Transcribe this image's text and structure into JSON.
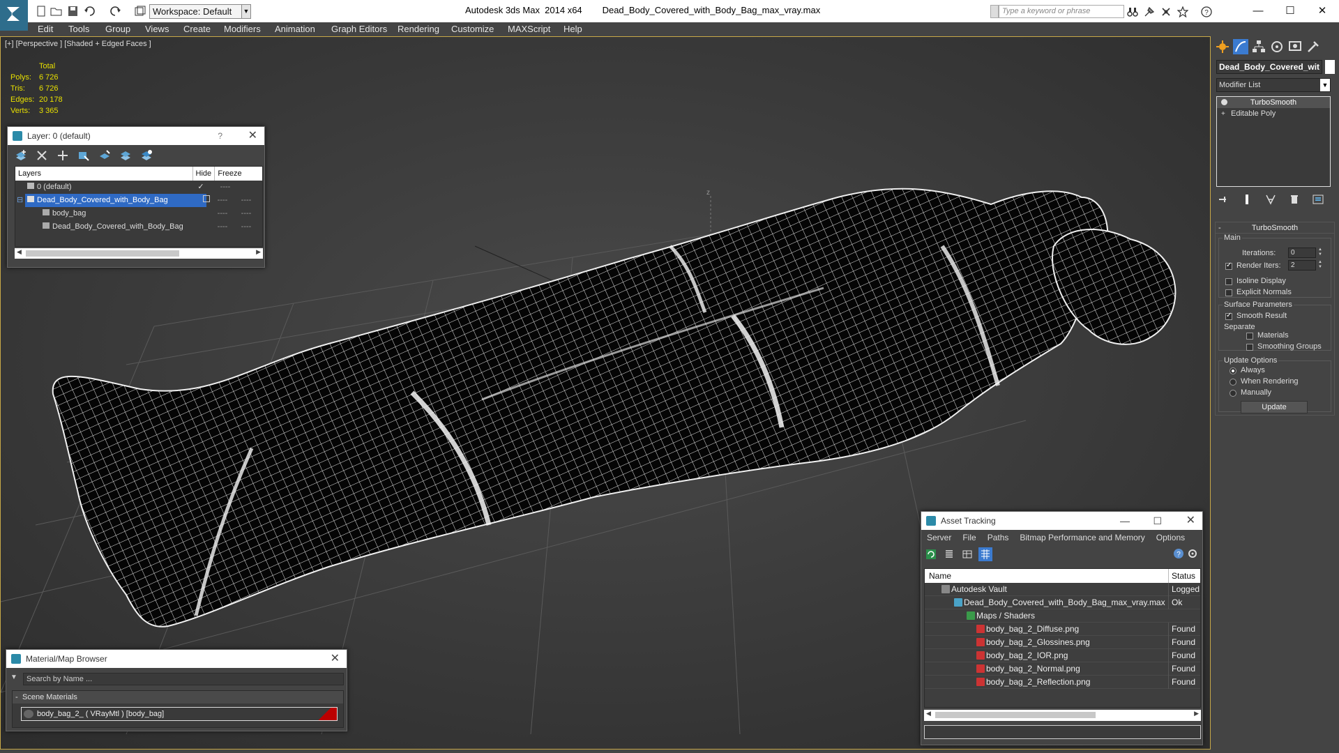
{
  "app": {
    "title": "Autodesk 3ds Max  2014 x64",
    "file": "Dead_Body_Covered_with_Body_Bag_max_vray.max",
    "workspace": "Workspace: Default",
    "search_placeholder": "Type a keyword or phrase"
  },
  "menu": [
    "Edit",
    "Tools",
    "Group",
    "Views",
    "Create",
    "Modifiers",
    "Animation",
    "Graph Editors",
    "Rendering",
    "Customize",
    "MAXScript",
    "Help"
  ],
  "viewport": {
    "label": "[+] [Perspective ] [Shaded + Edged Faces ]",
    "stats": {
      "header": "Total",
      "rows": [
        {
          "k": "Polys:",
          "v": "6 726"
        },
        {
          "k": "Tris:",
          "v": "6 726"
        },
        {
          "k": "Edges:",
          "v": "20 178"
        },
        {
          "k": "Verts:",
          "v": "3 365"
        }
      ]
    },
    "axis_label": "z"
  },
  "layer_panel": {
    "title": "Layer: 0 (default)",
    "help": "?",
    "columns": {
      "layers": "Layers",
      "hide": "Hide",
      "freeze": "Freeze"
    },
    "rows": [
      {
        "name": "0 (default)",
        "hide": "✓",
        "freeze": "----"
      },
      {
        "name": "Dead_Body_Covered_with_Body_Bag",
        "hide": "",
        "freeze": "----"
      },
      {
        "name": "body_bag",
        "hide": "----",
        "freeze": "----"
      },
      {
        "name": "Dead_Body_Covered_with_Body_Bag",
        "hide": "----",
        "freeze": "----"
      }
    ],
    "row2_hide_dashes": "----"
  },
  "material_browser": {
    "title": "Material/Map Browser",
    "search_placeholder": "Search by Name ...",
    "group": "Scene Materials",
    "item": "body_bag_2_  ( VRayMtl ) [body_bag]"
  },
  "asset_tracking": {
    "title": "Asset Tracking",
    "menu": [
      "Server",
      "File",
      "Paths",
      "Bitmap Performance and Memory",
      "Options"
    ],
    "columns": {
      "name": "Name",
      "status": "Status"
    },
    "rows": [
      {
        "name": "Autodesk Vault",
        "status": "Logged Out",
        "indent": 1,
        "icon": "vault-icon"
      },
      {
        "name": "Dead_Body_Covered_with_Body_Bag_max_vray.max",
        "status": "Ok",
        "indent": 2,
        "icon": "max-file-icon"
      },
      {
        "name": "Maps / Shaders",
        "status": "",
        "indent": 3,
        "icon": "maps-icon"
      },
      {
        "name": "body_bag_2_Diffuse.png",
        "status": "Found",
        "indent": 4,
        "icon": "png-icon"
      },
      {
        "name": "body_bag_2_Glossines.png",
        "status": "Found",
        "indent": 4,
        "icon": "png-icon"
      },
      {
        "name": "body_bag_2_IOR.png",
        "status": "Found",
        "indent": 4,
        "icon": "png-icon"
      },
      {
        "name": "body_bag_2_Normal.png",
        "status": "Found",
        "indent": 4,
        "icon": "png-icon"
      },
      {
        "name": "body_bag_2_Reflection.png",
        "status": "Found",
        "indent": 4,
        "icon": "png-icon"
      }
    ]
  },
  "command_panel": {
    "object_name": "Dead_Body_Covered_wit",
    "modifier_list": "Modifier List",
    "stack": [
      "TurboSmooth",
      "Editable Poly"
    ],
    "turbosmooth": {
      "title": "TurboSmooth",
      "main": "Main",
      "iterations_label": "Iterations:",
      "iterations": "0",
      "render_iters_label": "Render Iters:",
      "render_iters": "2",
      "isoline": "Isoline Display",
      "explicit_normals": "Explicit Normals",
      "surface_params": "Surface Parameters",
      "smooth_result": "Smooth Result",
      "separate": "Separate",
      "materials": "Materials",
      "smoothing_groups": "Smoothing Groups",
      "update_options": "Update Options",
      "always": "Always",
      "when_rendering": "When Rendering",
      "manually": "Manually",
      "update": "Update"
    }
  },
  "colors": {
    "accent_blue": "#2f6ac4",
    "viewport_border": "#c8a948",
    "stats_yellow": "#e8e000"
  }
}
